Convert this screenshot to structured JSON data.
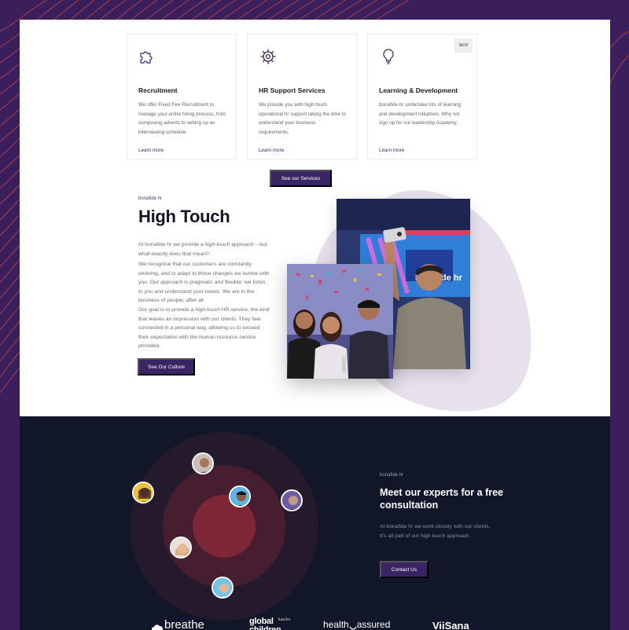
{
  "services": [
    {
      "icon": "puzzle-icon",
      "title": "Recruitment",
      "description": "We offer Fixed Fee Recruitment to manage your entire hiring process, from composing adverts to setting up an interviewing schedule.",
      "link": "Learn more"
    },
    {
      "icon": "gear-icon",
      "title": "HR Support Services",
      "description": "We provide you with high touch operational hr support taking the time to understand your business requirements.",
      "link": "Learn more"
    },
    {
      "icon": "lightbulb-icon",
      "title": "Learning & Development",
      "description": "bonafide hr undertake lots of learning and development initiatives. Why not sign up for our leadership Academy.",
      "link": "Learn more",
      "badge": "NEW"
    }
  ],
  "services_button": "See our Services",
  "high_touch": {
    "eyebrow": "bonafide hr",
    "title": "High Touch",
    "intro_pre": "At bonafide hr we provide a ",
    "intro_em": "high-touch",
    "intro_post": " approach – but what exactly does that mean?",
    "paragraph2": "We recognise that our customers are constantly evolving, and to adapt to those changes we evolve with you. Our approach is pragmatic and flexible; we listen to you and understand your needs. We are in the business of people, after all.",
    "p3_pre": "Our goal is to provide a ",
    "p3_em": "high-touch",
    "p3_post": " HR service, the kind that leaves an impression with our clients. They feel connected in a personal way, allowing us to exceed their expectation with the human resource service provided.",
    "button": "See Our Culture"
  },
  "consultation": {
    "eyebrow": "bonafide hr",
    "title": "Meet our experts for a free consultation",
    "text": "At bonafide hr we work closely with our clients. It's all part of our high touch approach.",
    "button": "Contact Us"
  },
  "logos": {
    "breathe": "breathe",
    "global_main": "global",
    "global_small": "fund for",
    "global_bottom": "children",
    "health": "health",
    "assured": "assured",
    "viisana": "ViiSana"
  },
  "colors": {
    "brand_purple": "#3b2464",
    "dark_navy": "#111629",
    "accent_red": "#c0313f"
  }
}
